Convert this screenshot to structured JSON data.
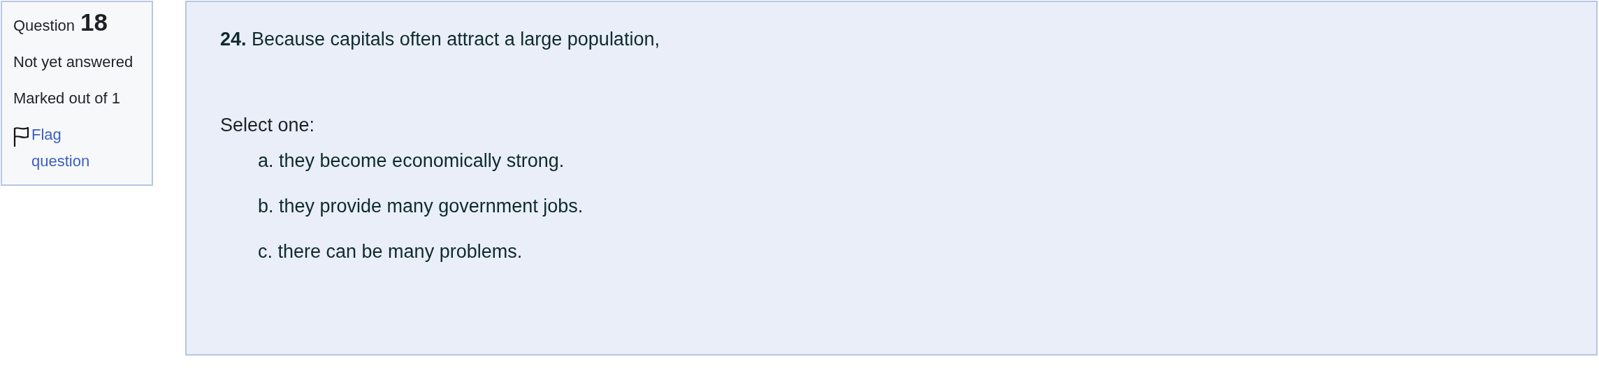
{
  "info": {
    "label": "Question",
    "number": "18",
    "status": "Not yet answered",
    "marks": "Marked out of 1",
    "flag": "Flag question"
  },
  "question": {
    "text": "**24.** Because capitals often attract a large population,",
    "prompt": "Select one:",
    "options": [
      {
        "text": "a. they become economically strong."
      },
      {
        "text": "b. they provide many government jobs."
      },
      {
        "text": "c. there can be many problems."
      }
    ]
  }
}
